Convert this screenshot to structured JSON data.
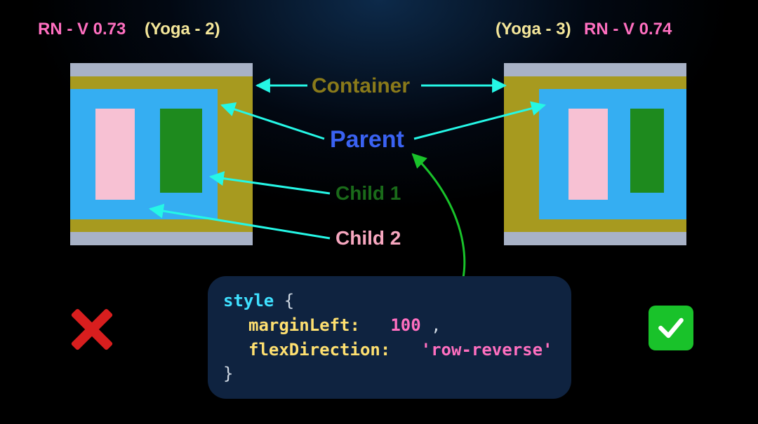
{
  "header": {
    "left_version": "RN - V 0.73",
    "left_yoga": "(Yoga - 2)",
    "right_yoga": "(Yoga - 3)",
    "right_version": "RN - V 0.74"
  },
  "labels": {
    "container": "Container",
    "parent": "Parent",
    "child1": "Child 1",
    "child2": "Child 2"
  },
  "code": {
    "keyword_style": "style",
    "brace_open": "{",
    "brace_close": "}",
    "prop_margin": "marginLeft:",
    "val_margin": "100",
    "comma": " ,",
    "prop_flex": "flexDirection:",
    "val_flex": "'row-reverse'"
  },
  "semantics": {
    "left_result": "incorrect",
    "right_result": "correct"
  }
}
